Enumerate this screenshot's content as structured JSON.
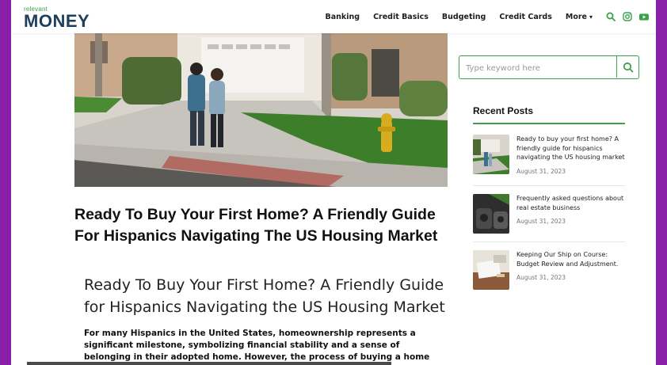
{
  "logo": {
    "small": "relevant",
    "big": "MONEY"
  },
  "nav": {
    "items": [
      "Banking",
      "Credit Basics",
      "Budgeting",
      "Credit Cards"
    ],
    "more_label": "More"
  },
  "icons": {
    "search": "search-icon",
    "instagram": "instagram-icon",
    "youtube": "youtube-icon",
    "accent_color": "#3aa347",
    "brand_color": "#1d3f5e"
  },
  "article": {
    "title": "Ready To Buy Your First Home? A Friendly Guide For Hispanics Navigating The US Housing Market",
    "subtitle": "Ready To Buy Your First Home? A Friendly Guide for Hispanics Navigating the US Housing Market",
    "intro": "For many Hispanics in the United States, homeownership represents a significant milestone, symbolizing financial stability and a sense of belonging in their adopted home. However, the process of buying a home can often seem daunting, especially"
  },
  "sidebar": {
    "search_placeholder": "Type keyword here",
    "recent_heading": "Recent Posts",
    "posts": [
      {
        "title": "Ready to buy your first home? A friendly guide for hispanics navigating the US housing market",
        "date": "August 31, 2023"
      },
      {
        "title": "Frequently asked questions about real estate business",
        "date": "August 31, 2023"
      },
      {
        "title": "Keeping Our Ship on Course: Budget Review and Adjustment.",
        "date": "August 31, 2023"
      }
    ]
  }
}
